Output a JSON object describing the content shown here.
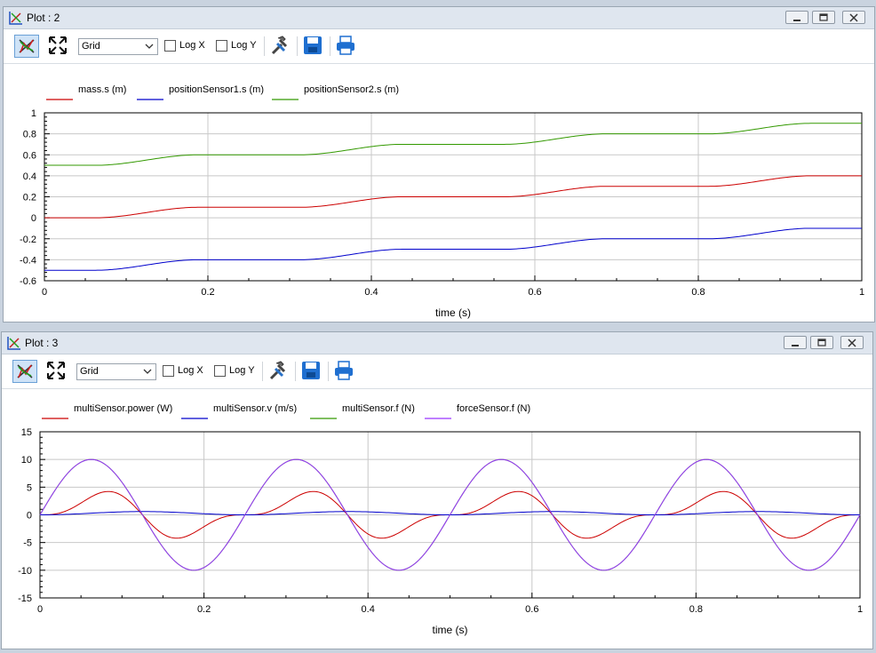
{
  "plots": [
    {
      "title": "Plot : 2",
      "toolbar": {
        "grid_select": "Grid",
        "logx_label": "Log X",
        "logy_label": "Log Y",
        "logx_checked": false,
        "logy_checked": false
      },
      "chart_data": {
        "type": "line",
        "xlabel": "time (s)",
        "xlim": [
          0,
          1
        ],
        "ylim": [
          -0.6,
          1
        ],
        "xticks": [
          "0",
          "0.2",
          "0.4",
          "0.6",
          "0.8",
          "1"
        ],
        "yticks": [
          "1",
          "0.8",
          "0.6",
          "0.4",
          "0.2",
          "0",
          "-0.2",
          "-0.4",
          "-0.6"
        ],
        "grid": true,
        "legend_position": "top-left",
        "series": [
          {
            "name": "mass.s (m)",
            "color": "#cc0000",
            "shape": "step",
            "base": 0.0,
            "step": 0.1,
            "period": 0.25,
            "offset": 0.0
          },
          {
            "name": "positionSensor1.s (m)",
            "color": "#0000cc",
            "shape": "step",
            "base": -0.5,
            "step": 0.1,
            "period": 0.25,
            "offset": 0.0
          },
          {
            "name": "positionSensor2.s (m)",
            "color": "#339900",
            "shape": "step",
            "base": 0.5,
            "step": 0.1,
            "period": 0.25,
            "offset": 0.0
          }
        ]
      }
    },
    {
      "title": "Plot : 3",
      "toolbar": {
        "grid_select": "Grid",
        "logx_label": "Log X",
        "logy_label": "Log Y",
        "logx_checked": false,
        "logy_checked": false
      },
      "chart_data": {
        "type": "line",
        "xlabel": "time (s)",
        "xlim": [
          0,
          1
        ],
        "ylim": [
          -15,
          15
        ],
        "xticks": [
          "0",
          "0.2",
          "0.4",
          "0.6",
          "0.8",
          "1"
        ],
        "yticks": [
          "15",
          "10",
          "5",
          "0",
          "-5",
          "-10",
          "-15"
        ],
        "grid": true,
        "legend_position": "top-left",
        "series": [
          {
            "name": "multiSensor.power (W)",
            "color": "#cc0000",
            "shape": "power",
            "amplitude": 5,
            "period": 0.25
          },
          {
            "name": "multiSensor.v (m/s)",
            "color": "#0000cc",
            "shape": "velocity",
            "amplitude": 0.6,
            "period": 0.25
          },
          {
            "name": "multiSensor.f (N)",
            "color": "#339900",
            "shape": "force",
            "amplitude": 10,
            "period": 0.25
          },
          {
            "name": "forceSensor.f (N)",
            "color": "#9933ff",
            "shape": "force",
            "amplitude": 10,
            "period": 0.25
          }
        ]
      }
    }
  ]
}
